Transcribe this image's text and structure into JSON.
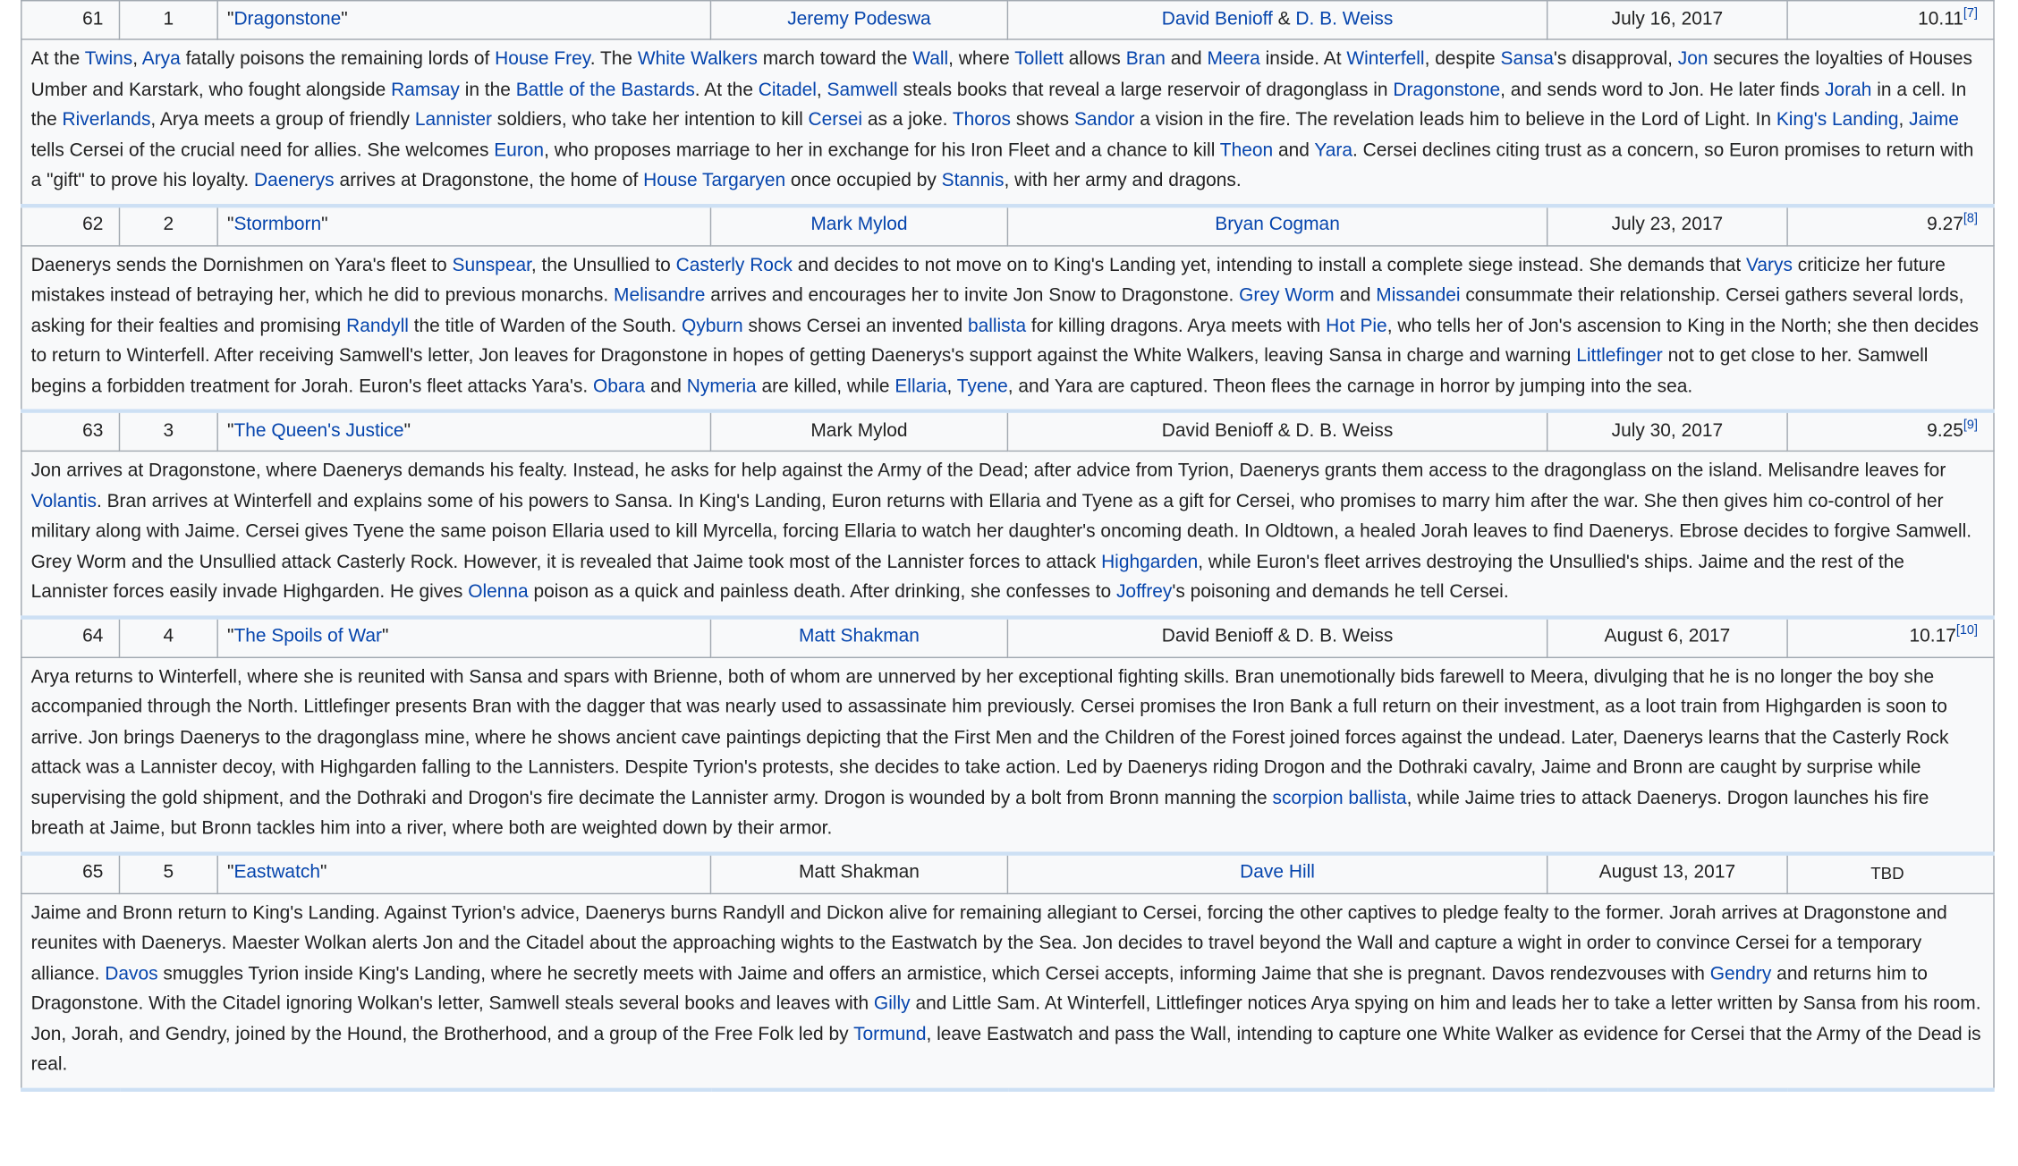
{
  "episodes": [
    {
      "overall": "61",
      "season_no": "1",
      "title_open": "\"",
      "title": "Dragonstone",
      "title_close": "\"",
      "directors": [
        "Jeremy Podeswa"
      ],
      "writers": [
        "David Benioff",
        " & ",
        "D. B. Weiss"
      ],
      "air_date": "July 16, 2017",
      "viewers": "10.11",
      "ref": "[7]",
      "summary": [
        {
          "t": "At the "
        },
        {
          "t": "Twins",
          "l": true
        },
        {
          "t": ", "
        },
        {
          "t": "Arya",
          "l": true
        },
        {
          "t": " fatally poisons the remaining lords of "
        },
        {
          "t": "House Frey",
          "l": true
        },
        {
          "t": ". The "
        },
        {
          "t": "White Walkers",
          "l": true
        },
        {
          "t": " march toward the "
        },
        {
          "t": "Wall",
          "l": true
        },
        {
          "t": ", where "
        },
        {
          "t": "Tollett",
          "l": true
        },
        {
          "t": " allows "
        },
        {
          "t": "Bran",
          "l": true
        },
        {
          "t": " and "
        },
        {
          "t": "Meera",
          "l": true
        },
        {
          "t": " inside. At "
        },
        {
          "t": "Winterfell",
          "l": true
        },
        {
          "t": ", despite "
        },
        {
          "t": "Sansa",
          "l": true
        },
        {
          "t": "'s disapproval, "
        },
        {
          "t": "Jon",
          "l": true
        },
        {
          "t": " secures the loyalties of Houses Umber and Karstark, who fought alongside "
        },
        {
          "t": "Ramsay",
          "l": true
        },
        {
          "t": " in the "
        },
        {
          "t": "Battle of the Bastards",
          "l": true
        },
        {
          "t": ". At the "
        },
        {
          "t": "Citadel",
          "l": true
        },
        {
          "t": ", "
        },
        {
          "t": "Samwell",
          "l": true
        },
        {
          "t": " steals books that reveal a large reservoir of dragonglass in "
        },
        {
          "t": "Dragonstone",
          "l": true
        },
        {
          "t": ", and sends word to Jon. He later finds "
        },
        {
          "t": "Jorah",
          "l": true
        },
        {
          "t": " in a cell. In the "
        },
        {
          "t": "Riverlands",
          "l": true
        },
        {
          "t": ", Arya meets a group of friendly "
        },
        {
          "t": "Lannister",
          "l": true
        },
        {
          "t": " soldiers, who take her intention to kill "
        },
        {
          "t": "Cersei",
          "l": true
        },
        {
          "t": " as a joke. "
        },
        {
          "t": "Thoros",
          "l": true
        },
        {
          "t": " shows "
        },
        {
          "t": "Sandor",
          "l": true
        },
        {
          "t": " a vision in the fire. The revelation leads him to believe in the Lord of Light. In "
        },
        {
          "t": "King's Landing",
          "l": true
        },
        {
          "t": ", "
        },
        {
          "t": "Jaime",
          "l": true
        },
        {
          "t": " tells Cersei of the crucial need for allies. She welcomes "
        },
        {
          "t": "Euron",
          "l": true
        },
        {
          "t": ", who proposes marriage to her in exchange for his Iron Fleet and a chance to kill "
        },
        {
          "t": "Theon",
          "l": true
        },
        {
          "t": " and "
        },
        {
          "t": "Yara",
          "l": true
        },
        {
          "t": ". Cersei declines citing trust as a concern, so Euron promises to return with a \"gift\" to prove his loyalty. "
        },
        {
          "t": "Daenerys",
          "l": true
        },
        {
          "t": " arrives at Dragonstone, the home of "
        },
        {
          "t": "House Targaryen",
          "l": true
        },
        {
          "t": " once occupied by "
        },
        {
          "t": "Stannis",
          "l": true
        },
        {
          "t": ", with her army and dragons."
        }
      ]
    },
    {
      "overall": "62",
      "season_no": "2",
      "title_open": "\"",
      "title": "Stormborn",
      "title_close": "\"",
      "directors": [
        "Mark Mylod"
      ],
      "writers": [
        "Bryan Cogman"
      ],
      "air_date": "July 23, 2017",
      "viewers": "9.27",
      "ref": "[8]",
      "summary": [
        {
          "t": "Daenerys sends the Dornishmen on Yara's fleet to "
        },
        {
          "t": "Sunspear",
          "l": true
        },
        {
          "t": ", the Unsullied to "
        },
        {
          "t": "Casterly Rock",
          "l": true
        },
        {
          "t": " and decides to not move on to King's Landing yet, intending to install a complete siege instead. She demands that "
        },
        {
          "t": "Varys",
          "l": true
        },
        {
          "t": " criticize her future mistakes instead of betraying her, which he did to previous monarchs. "
        },
        {
          "t": "Melisandre",
          "l": true
        },
        {
          "t": " arrives and encourages her to invite Jon Snow to Dragonstone. "
        },
        {
          "t": "Grey Worm",
          "l": true
        },
        {
          "t": " and "
        },
        {
          "t": "Missandei",
          "l": true
        },
        {
          "t": " consummate their relationship. Cersei gathers several lords, asking for their fealties and promising "
        },
        {
          "t": "Randyll",
          "l": true
        },
        {
          "t": " the title of Warden of the South. "
        },
        {
          "t": "Qyburn",
          "l": true
        },
        {
          "t": " shows Cersei an invented "
        },
        {
          "t": "ballista",
          "l": true
        },
        {
          "t": " for killing dragons. Arya meets with "
        },
        {
          "t": "Hot Pie",
          "l": true
        },
        {
          "t": ", who tells her of Jon's ascension to King in the North; she then decides to return to Winterfell. After receiving Samwell's letter, Jon leaves for Dragonstone in hopes of getting Daenerys's support against the White Walkers, leaving Sansa in charge and warning "
        },
        {
          "t": "Littlefinger",
          "l": true
        },
        {
          "t": " not to get close to her. Samwell begins a forbidden treatment for Jorah. Euron's fleet attacks Yara's. "
        },
        {
          "t": "Obara",
          "l": true
        },
        {
          "t": " and "
        },
        {
          "t": "Nymeria",
          "l": true
        },
        {
          "t": " are killed, while "
        },
        {
          "t": "Ellaria",
          "l": true
        },
        {
          "t": ", "
        },
        {
          "t": "Tyene",
          "l": true
        },
        {
          "t": ", and Yara are captured. Theon flees the carnage in horror by jumping into the sea."
        }
      ]
    },
    {
      "overall": "63",
      "season_no": "3",
      "title_open": "\"",
      "title": "The Queen's Justice",
      "title_close": "\"",
      "directors_plain": "Mark Mylod",
      "writers_plain": "David Benioff & D. B. Weiss",
      "air_date": "July 30, 2017",
      "viewers": "9.25",
      "ref": "[9]",
      "summary": [
        {
          "t": "Jon arrives at Dragonstone, where Daenerys demands his fealty. Instead, he asks for help against the Army of the Dead; after advice from Tyrion, Daenerys grants them access to the dragonglass on the island. Melisandre leaves for "
        },
        {
          "t": "Volantis",
          "l": true
        },
        {
          "t": ". Bran arrives at Winterfell and explains some of his powers to Sansa. In King's Landing, Euron returns with Ellaria and Tyene as a gift for Cersei, who promises to marry him after the war. She then gives him co-control of her military along with Jaime. Cersei gives Tyene the same poison Ellaria used to kill Myrcella, forcing Ellaria to watch her daughter's oncoming death. In Oldtown, a healed Jorah leaves to find Daenerys. Ebrose decides to forgive Samwell. Grey Worm and the Unsullied attack Casterly Rock. However, it is revealed that Jaime took most of the Lannister forces to attack "
        },
        {
          "t": "Highgarden",
          "l": true
        },
        {
          "t": ", while Euron's fleet arrives destroying the Unsullied's ships. Jaime and the rest of the Lannister forces easily invade Highgarden. He gives "
        },
        {
          "t": "Olenna",
          "l": true
        },
        {
          "t": " poison as a quick and painless death. After drinking, she confesses to "
        },
        {
          "t": "Joffrey",
          "l": true
        },
        {
          "t": "'s poisoning and demands he tell Cersei."
        }
      ]
    },
    {
      "overall": "64",
      "season_no": "4",
      "title_open": "\"",
      "title": "The Spoils of War",
      "title_close": "\"",
      "directors": [
        "Matt Shakman"
      ],
      "writers_plain": "David Benioff & D. B. Weiss",
      "air_date": "August 6, 2017",
      "viewers": "10.17",
      "ref": "[10]",
      "summary": [
        {
          "t": "Arya returns to Winterfell, where she is reunited with Sansa and spars with Brienne, both of whom are unnerved by her exceptional fighting skills. Bran unemotionally bids farewell to Meera, divulging that he is no longer the boy she accompanied through the North. Littlefinger presents Bran with the dagger that was nearly used to assassinate him previously. Cersei promises the Iron Bank a full return on their investment, as a loot train from Highgarden is soon to arrive. Jon brings Daenerys to the dragonglass mine, where he shows ancient cave paintings depicting that the First Men and the Children of the Forest joined forces against the undead. Later, Daenerys learns that the Casterly Rock attack was a Lannister decoy, with Highgarden falling to the Lannisters. Despite Tyrion's protests, she decides to take action. Led by Daenerys riding Drogon and the Dothraki cavalry, Jaime and Bronn are caught by surprise while supervising the gold shipment, and the Dothraki and Drogon's fire decimate the Lannister army. Drogon is wounded by a bolt from Bronn manning the "
        },
        {
          "t": "scorpion ballista",
          "l": true
        },
        {
          "t": ", while Jaime tries to attack Daenerys. Drogon launches his fire breath at Jaime, but Bronn tackles him into a river, where both are weighted down by their armor."
        }
      ]
    },
    {
      "overall": "65",
      "season_no": "5",
      "title_open": "\"",
      "title": "Eastwatch",
      "title_close": "\"",
      "directors_plain": "Matt Shakman",
      "writers": [
        "Dave Hill"
      ],
      "air_date": "August 13, 2017",
      "viewers_tbd": "TBD",
      "summary": [
        {
          "t": "Jaime and Bronn return to King's Landing. Against Tyrion's advice, Daenerys burns Randyll and Dickon alive for remaining allegiant to Cersei, forcing the other captives to pledge fealty to the former. Jorah arrives at Dragonstone and reunites with Daenerys. Maester Wolkan alerts Jon and the Citadel about the approaching wights to the Eastwatch by the Sea. Jon decides to travel beyond the Wall and capture a wight in order to convince Cersei for a temporary alliance. "
        },
        {
          "t": "Davos",
          "l": true
        },
        {
          "t": " smuggles Tyrion inside King's Landing, where he secretly meets with Jaime and offers an armistice, which Cersei accepts, informing Jaime that she is pregnant. Davos rendezvouses with "
        },
        {
          "t": "Gendry",
          "l": true
        },
        {
          "t": " and returns him to Dragonstone. With the Citadel ignoring Wolkan's letter, Samwell steals several books and leaves with "
        },
        {
          "t": "Gilly",
          "l": true
        },
        {
          "t": " and Little Sam. At Winterfell, Littlefinger notices Arya spying on him and leads her to take a letter written by Sansa from his room. Jon, Jorah, and Gendry, joined by the Hound, the Brotherhood, and a group of the Free Folk led by "
        },
        {
          "t": "Tormund",
          "l": true
        },
        {
          "t": ", leave Eastwatch and pass the Wall, intending to capture one White Walker as evidence for Cersei that the Army of the Dead is real."
        }
      ]
    }
  ]
}
